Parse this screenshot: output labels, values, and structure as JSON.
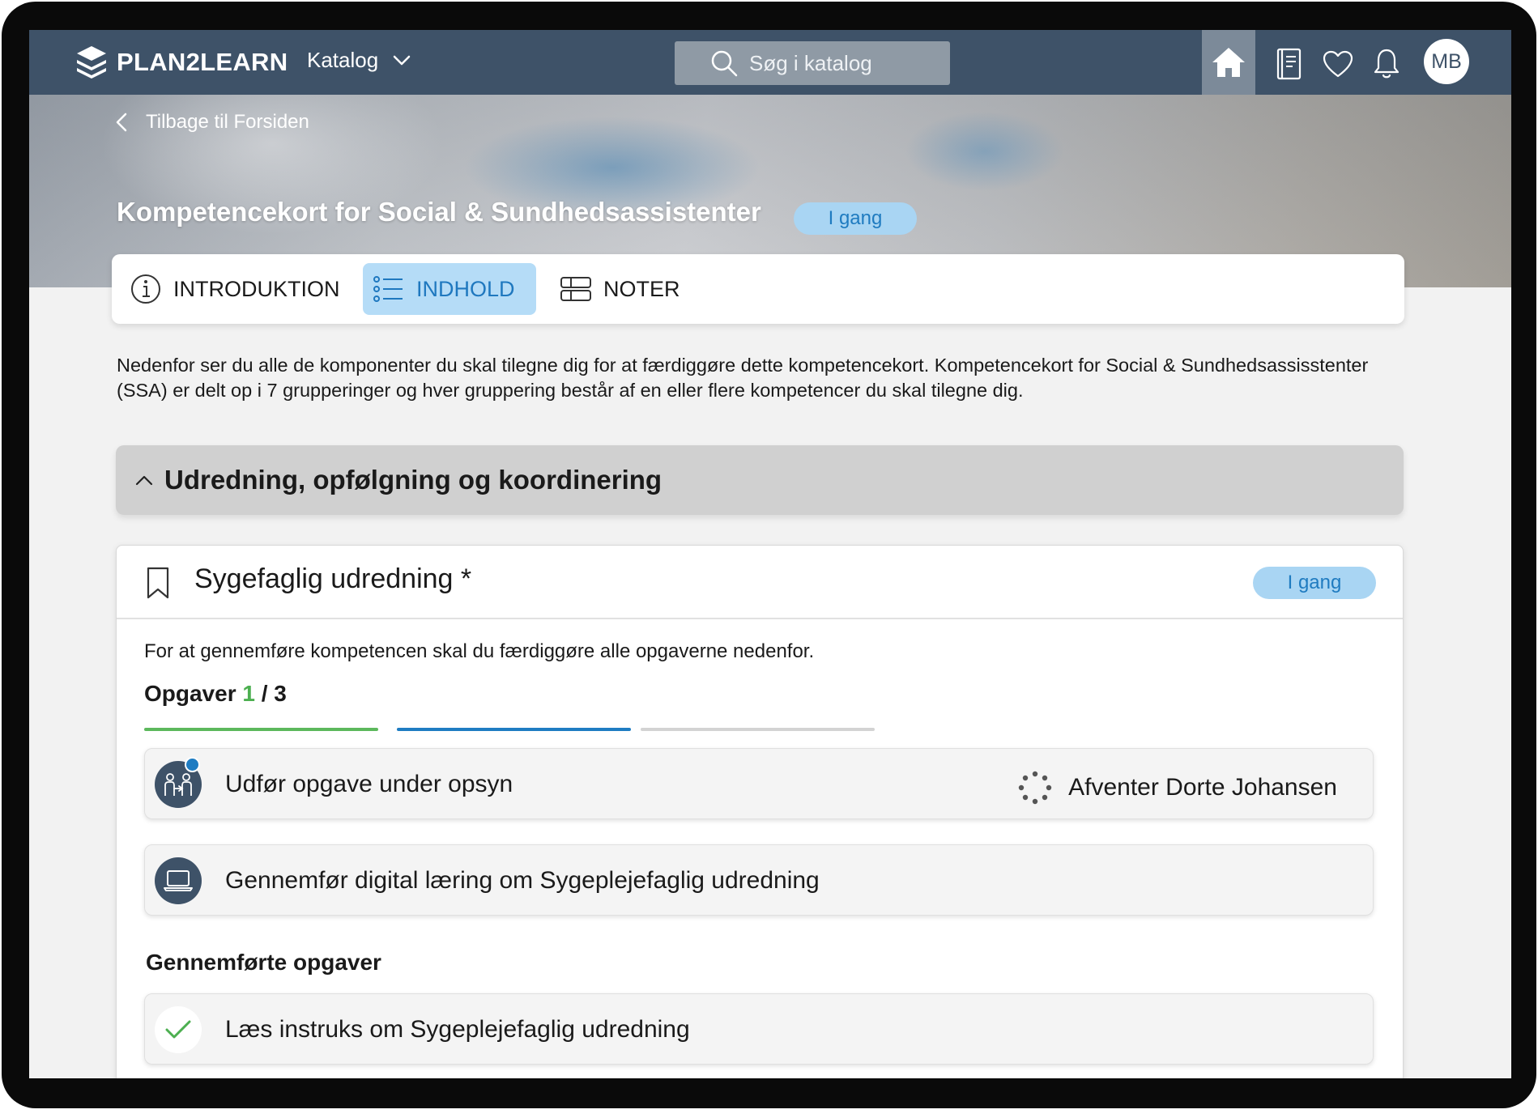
{
  "header": {
    "brand": "PLAN2LEARN",
    "catalog_label": "Katalog",
    "search_placeholder": "Søg i katalog",
    "avatar_initials": "MB",
    "nav_icons": [
      "home-icon",
      "book-icon",
      "heart-icon",
      "bell-icon"
    ]
  },
  "hero": {
    "back_label": "Tilbage til Forsiden",
    "title": "Kompetencekort for Social & Sundhedsassistenter",
    "status": "I gang"
  },
  "tabs": [
    {
      "label": "INTRODUKTION",
      "icon": "info-icon",
      "active": false
    },
    {
      "label": "INDHOLD",
      "icon": "list-icon",
      "active": true
    },
    {
      "label": "NOTER",
      "icon": "notes-icon",
      "active": false
    }
  ],
  "intro_text": "Nedenfor ser du alle de komponenter du skal tilegne dig for at færdiggøre dette kompetencekort. Kompetencekort for Social & Sundhedsassisstenter (SSA) er delt op i 7 grupperinger og hver gruppering består af en eller flere kompetencer du skal tilegne dig.",
  "section": {
    "title": "Udredning, opfølgning og koordinering",
    "expanded": true
  },
  "competence": {
    "title": "Sygefaglig udredning *",
    "status": "I gang",
    "description": "For at gennemføre kompetencen skal du færdiggøre alle opgaverne nedenfor.",
    "tasks_label": "Opgaver",
    "tasks_done": "1",
    "tasks_total": "/ 3",
    "progress_colors": [
      "#5cb85c",
      "#1e7cc2",
      "#d3d3d3"
    ],
    "tasks": [
      {
        "label": "Udfør opgave under opsyn",
        "status": "Afventer Dorte Johansen",
        "icon": "supervision-icon"
      },
      {
        "label": "Gennemfør digital læring om Sygeplejefaglig udredning",
        "status": "",
        "icon": "laptop-icon"
      }
    ],
    "completed_heading": "Gennemførte opgaver",
    "completed_tasks": [
      {
        "label": "Læs instruks om Sygeplejefaglig udredning",
        "icon": "checkmark-icon"
      }
    ]
  },
  "colors": {
    "topbar": "#3e5268",
    "accent": "#1e7cc2",
    "badge_bg": "#a9d5f3",
    "success": "#4caf50"
  }
}
